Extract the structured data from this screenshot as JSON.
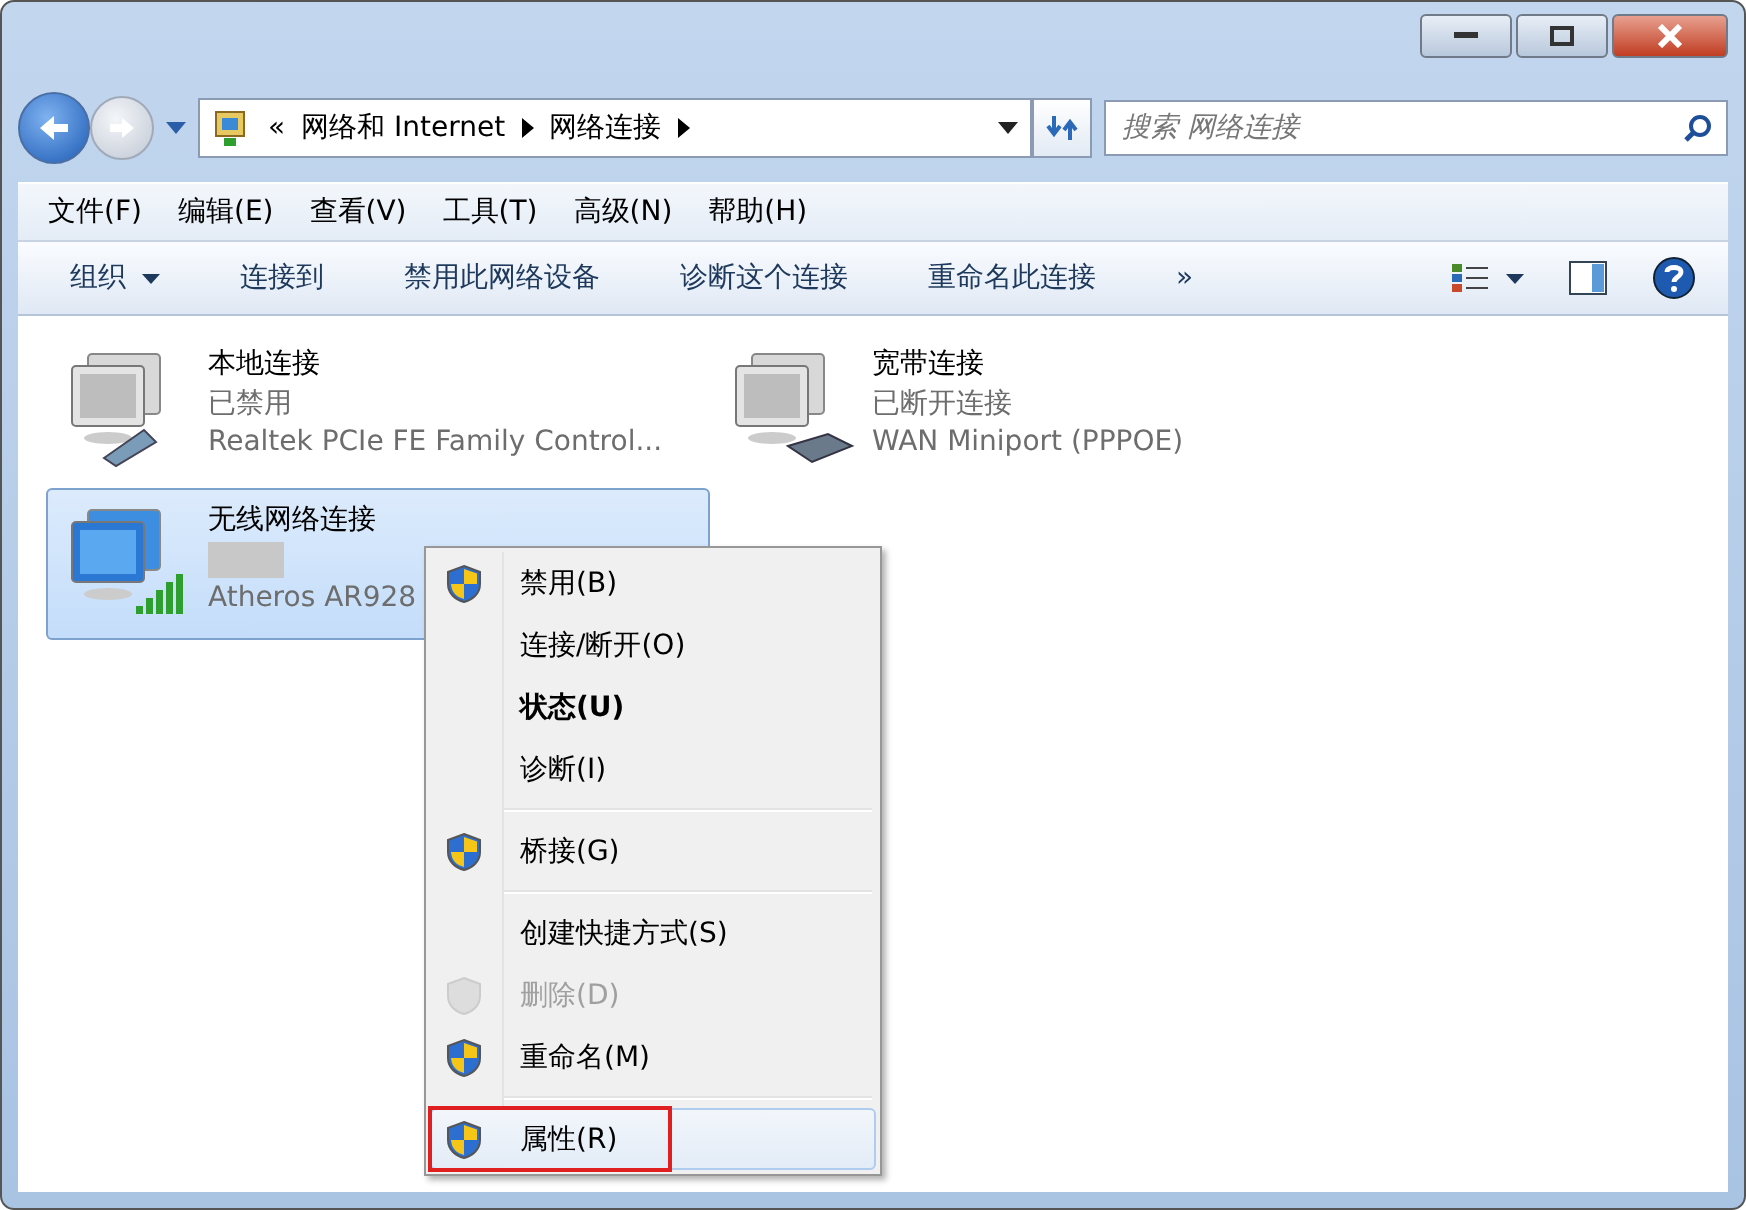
{
  "address_bar": {
    "crumbs": [
      "«",
      "网络和 Internet",
      "网络连接"
    ]
  },
  "search": {
    "placeholder": "搜索 网络连接"
  },
  "menu_bar": [
    "文件(F)",
    "编辑(E)",
    "查看(V)",
    "工具(T)",
    "高级(N)",
    "帮助(H)"
  ],
  "toolbar": [
    {
      "label": "组织",
      "dropdown": true
    },
    {
      "label": "连接到",
      "dropdown": false
    },
    {
      "label": "禁用此网络设备",
      "dropdown": false
    },
    {
      "label": "诊断这个连接",
      "dropdown": false
    },
    {
      "label": "重命名此连接",
      "dropdown": false
    },
    {
      "label": "»",
      "dropdown": false
    }
  ],
  "connections": [
    {
      "kind": "wired",
      "name": "本地连接",
      "status": "已禁用",
      "device": "Realtek PCIe FE Family Control...",
      "selected": false,
      "status_hidden": false
    },
    {
      "kind": "broadband",
      "name": "宽带连接",
      "status": "已断开连接",
      "device": "WAN Miniport (PPPOE)",
      "selected": false,
      "status_hidden": false
    },
    {
      "kind": "wireless",
      "name": "无线网络连接",
      "device": "Atheros AR928",
      "selected": true,
      "status_hidden": true
    }
  ],
  "context_menu": [
    {
      "kind": "item",
      "label": "禁用(B)",
      "shield": true,
      "disabled": false,
      "default": false,
      "selected": false,
      "annotated": false
    },
    {
      "kind": "item",
      "label": "连接/断开(O)",
      "shield": false,
      "disabled": false,
      "default": false,
      "selected": false,
      "annotated": false
    },
    {
      "kind": "item",
      "label": "状态(U)",
      "shield": false,
      "disabled": false,
      "default": true,
      "selected": false,
      "annotated": false
    },
    {
      "kind": "item",
      "label": "诊断(I)",
      "shield": false,
      "disabled": false,
      "default": false,
      "selected": false,
      "annotated": false
    },
    {
      "kind": "separator"
    },
    {
      "kind": "item",
      "label": "桥接(G)",
      "shield": true,
      "disabled": false,
      "default": false,
      "selected": false,
      "annotated": false
    },
    {
      "kind": "separator"
    },
    {
      "kind": "item",
      "label": "创建快捷方式(S)",
      "shield": false,
      "disabled": false,
      "default": false,
      "selected": false,
      "annotated": false
    },
    {
      "kind": "item",
      "label": "删除(D)",
      "shield": true,
      "disabled": true,
      "default": false,
      "selected": false,
      "annotated": false
    },
    {
      "kind": "item",
      "label": "重命名(M)",
      "shield": true,
      "disabled": false,
      "default": false,
      "selected": false,
      "annotated": false
    },
    {
      "kind": "separator"
    },
    {
      "kind": "item",
      "label": "属性(R)",
      "shield": true,
      "disabled": false,
      "default": false,
      "selected": true,
      "annotated": true
    }
  ]
}
